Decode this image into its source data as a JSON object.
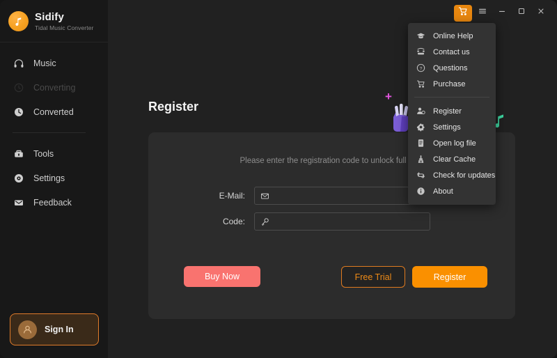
{
  "brand": {
    "name": "Sidify",
    "subtitle": "Tidal Music Converter",
    "logo_icon": "music-note-icon",
    "accent_color": "#f5a020"
  },
  "sidebar": {
    "items": [
      {
        "label": "Music",
        "icon": "headphones-icon",
        "state": "enabled"
      },
      {
        "label": "Converting",
        "icon": "refresh-icon",
        "state": "disabled"
      },
      {
        "label": "Converted",
        "icon": "clock-icon",
        "state": "enabled"
      },
      {
        "label": "Tools",
        "icon": "toolbox-icon",
        "state": "enabled"
      },
      {
        "label": "Settings",
        "icon": "gear-icon",
        "state": "enabled"
      },
      {
        "label": "Feedback",
        "icon": "envelope-icon",
        "state": "enabled"
      }
    ],
    "sign_in": {
      "label": "Sign In",
      "icon": "user-avatar-icon",
      "border_color": "#e07b2a"
    }
  },
  "titlebar": {
    "buttons": [
      {
        "name": "cart",
        "icon": "shopping-cart-icon",
        "active": true
      },
      {
        "name": "menu",
        "icon": "hamburger-menu-icon",
        "active": false
      },
      {
        "name": "minimize",
        "icon": "minimize-icon",
        "active": false
      },
      {
        "name": "maximize",
        "icon": "maximize-icon",
        "active": false
      },
      {
        "name": "close",
        "icon": "close-icon",
        "active": false
      }
    ]
  },
  "main": {
    "page_title": "Register",
    "card": {
      "hint": "Please enter the registration code to unlock full vers",
      "fields": [
        {
          "label": "E-Mail:",
          "value": "",
          "placeholder": "",
          "icon": "envelope-icon"
        },
        {
          "label": "Code:",
          "value": "",
          "placeholder": "",
          "icon": "key-icon"
        }
      ],
      "buttons": {
        "buy_now": {
          "label": "Buy Now",
          "color": "#f9736f"
        },
        "free_trial": {
          "label": "Free Trial",
          "color": "#ef8b17"
        },
        "register": {
          "label": "Register",
          "color": "#fa9000"
        }
      }
    },
    "decorations": {
      "plus": {
        "glyph": "+",
        "color": "#e455e0"
      },
      "hand": {
        "icon": "hand-illustration",
        "color": "#7a5ad6"
      },
      "note": {
        "icon": "music-note-icon",
        "color": "#3fd9a4"
      }
    }
  },
  "dropdown": {
    "group1": [
      {
        "label": "Online Help",
        "icon": "graduation-cap-icon"
      },
      {
        "label": "Contact us",
        "icon": "telephone-icon"
      },
      {
        "label": "Questions",
        "icon": "question-circle-icon"
      },
      {
        "label": "Purchase",
        "icon": "shopping-cart-icon"
      }
    ],
    "group2": [
      {
        "label": "Register",
        "icon": "user-gear-icon"
      },
      {
        "label": "Settings",
        "icon": "gear-icon"
      },
      {
        "label": "Open log file",
        "icon": "document-icon"
      },
      {
        "label": "Clear Cache",
        "icon": "broom-icon"
      },
      {
        "label": "Check for updates",
        "icon": "refresh-icon"
      },
      {
        "label": "About",
        "icon": "info-circle-icon"
      }
    ]
  }
}
